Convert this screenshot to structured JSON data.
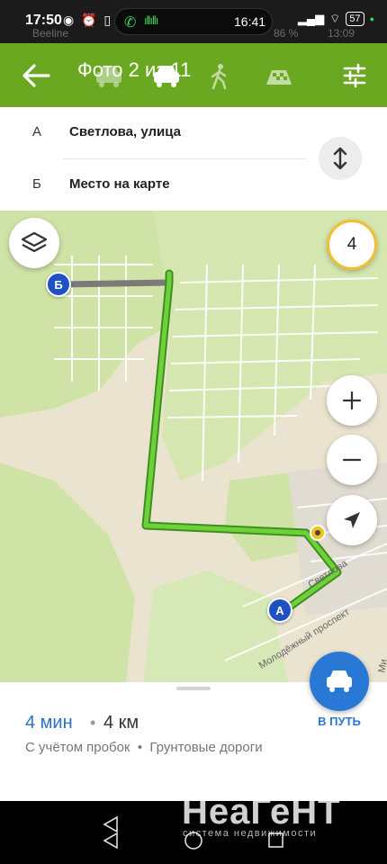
{
  "status_bar": {
    "time": "17:50",
    "call_time": "16:41",
    "battery": "57",
    "ghost_carrier": "Beeline",
    "ghost_battery": "86 %",
    "ghost_time": "13:09"
  },
  "header": {
    "title": "Фото 2 из 11",
    "icons": [
      "back-arrow-icon",
      "car-icon",
      "car-icon",
      "walk-icon",
      "taxi-icon",
      "filter-icon"
    ]
  },
  "route": {
    "from_letter": "А",
    "from_text": "Светлова, улица",
    "to_letter": "Б",
    "to_text": "Место на карте"
  },
  "map": {
    "traffic_level": "4",
    "marker_a": "А",
    "marker_b": "Б",
    "streets": [
      "Светлова",
      "Молодёжный проспект",
      "Ми"
    ],
    "colors": {
      "route": "#5fc12b",
      "grass": "#cfe3a6",
      "land": "#e9e3cf",
      "marker": "#2051c4"
    }
  },
  "summary": {
    "eta": "4 мин",
    "separator": "•",
    "distance": "4 км",
    "notes": "С учётом пробок  •  Грунтовые дороги",
    "go_label": "В ПУТЬ"
  },
  "watermark": {
    "title": "НеаГеНТ",
    "subtitle": "система недвижимости"
  }
}
